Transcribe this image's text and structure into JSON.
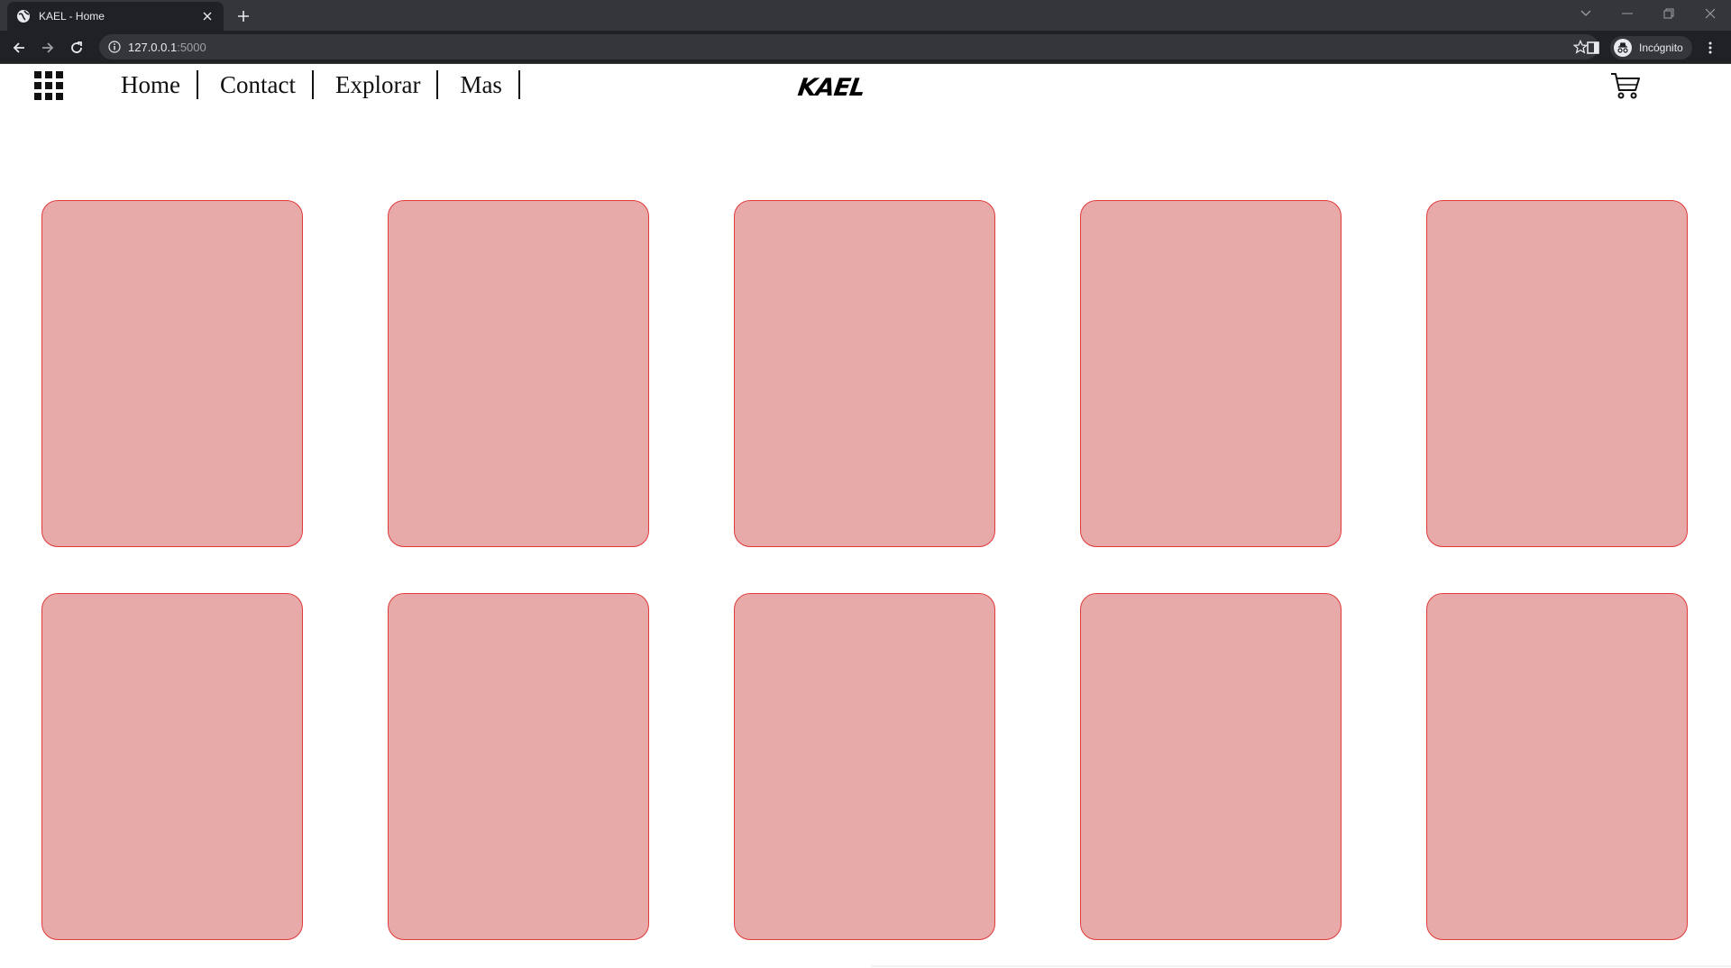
{
  "browser": {
    "tab": {
      "title": "KAEL - Home"
    },
    "address": {
      "host": "127.0.0.1",
      "port": ":5000"
    },
    "profile_label": "Incógnito"
  },
  "site": {
    "nav": [
      {
        "label": "Home"
      },
      {
        "label": "Contact"
      },
      {
        "label": "Explorar"
      },
      {
        "label": "Mas"
      }
    ],
    "logo": "KAEL",
    "card_count": 10,
    "colors": {
      "card_fill": "#e8a9a9",
      "card_border": "#e03b3b",
      "chrome_dark": "#202124"
    }
  }
}
